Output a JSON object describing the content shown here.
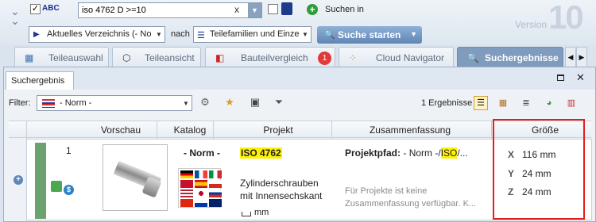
{
  "search": {
    "abc_label": "ABC",
    "query": "iso 4762 D >=10",
    "clear_glyph": "x",
    "suchen_in_label": "Suchen in"
  },
  "scope": {
    "directory": "Aktuelles Verzeichnis (- Norm - )",
    "nach_label": "nach",
    "field": "Teilefamilien und Einzelteile",
    "start_button": "Suche starten"
  },
  "version": {
    "label": "Version",
    "number": "10"
  },
  "tabs": [
    {
      "label": "Teileauswahl",
      "icon": "parts-selection-icon"
    },
    {
      "label": "Teileansicht",
      "icon": "part-view-icon"
    },
    {
      "label": "Bauteilvergleich",
      "icon": "part-compare-icon"
    },
    {
      "label": "Cloud Navigator",
      "icon": "cloud-navigator-icon",
      "badge": "1"
    },
    {
      "label": "Suchergebnisse",
      "icon": "search-results-icon",
      "active": true
    }
  ],
  "panel": {
    "title": "Suchergebnis",
    "filter_label": "Filter:",
    "filter_value": "- Norm -",
    "results_count": "1 Ergebnisse"
  },
  "table": {
    "columns": [
      "Vorschau",
      "Katalog",
      "Projekt",
      "Zusammenfassung",
      "Größe"
    ],
    "rows": [
      {
        "index": "1",
        "catalog": "- Norm -",
        "project_name": "ISO 4762",
        "project_desc": "Zylinderschrauben mit Innensechskant",
        "unit": "mm",
        "path_label": "Projektpfad:",
        "path_prefix": "- Norm -/",
        "path_highlight": "ISO",
        "path_suffix": "/...",
        "summary": "Für Projekte ist keine Zusammenfassung verfügbar. K...",
        "size": {
          "x": "116 mm",
          "y": "24 mm",
          "z": "24 mm"
        }
      }
    ]
  },
  "colors": {
    "accent": "#7f9bbd",
    "highlight": "#fff200",
    "annotation": "#e81c1c",
    "status_green": "#6aa36f"
  }
}
